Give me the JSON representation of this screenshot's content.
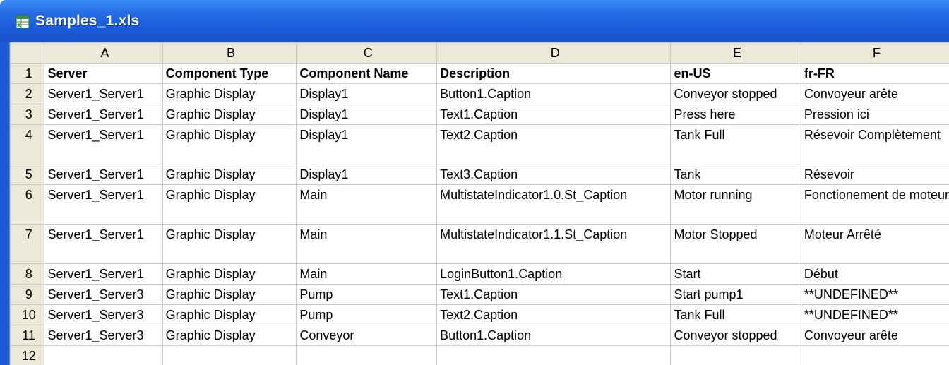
{
  "window": {
    "title": "Samples_1.xls",
    "icon": "excel-sheet-icon"
  },
  "colors": {
    "titlebar": "#2469e3",
    "header_bg": "#ece9d8",
    "grid_line": "#c8c8c8"
  },
  "columns": [
    "A",
    "B",
    "C",
    "D",
    "E",
    "F"
  ],
  "row_numbers": [
    "1",
    "2",
    "3",
    "4",
    "5",
    "6",
    "7",
    "8",
    "9",
    "10",
    "11",
    "12"
  ],
  "rows": [
    [
      "Server",
      "Component Type",
      "Component Name",
      "Description",
      "en-US",
      "fr-FR"
    ],
    [
      "Server1_Server1",
      "Graphic Display",
      "Display1",
      "Button1.Caption",
      "Conveyor stopped",
      "Convoyeur arête"
    ],
    [
      "Server1_Server1",
      "Graphic Display",
      "Display1",
      "Text1.Caption",
      "Press here",
      "Pression ici"
    ],
    [
      "Server1_Server1",
      "Graphic Display",
      "Display1",
      "Text2.Caption",
      "Tank Full",
      "Résevoir Complètement"
    ],
    [
      "Server1_Server1",
      "Graphic Display",
      "Display1",
      "Text3.Caption",
      "Tank",
      "Résevoir"
    ],
    [
      "Server1_Server1",
      "Graphic Display",
      "Main",
      "MultistateIndicator1.0.St_Caption",
      "Motor running",
      "Fonctionement de moteur"
    ],
    [
      "Server1_Server1",
      "Graphic Display",
      "Main",
      "MultistateIndicator1.1.St_Caption",
      "Motor Stopped",
      "Moteur Arrêté"
    ],
    [
      "Server1_Server1",
      "Graphic Display",
      "Main",
      "LoginButton1.Caption",
      "Start",
      "Début"
    ],
    [
      "Server1_Server3",
      "Graphic Display",
      "Pump",
      "Text1.Caption",
      "Start pump1",
      "**UNDEFINED**"
    ],
    [
      "Server1_Server3",
      "Graphic Display",
      "Pump",
      "Text2.Caption",
      "Tank Full",
      "**UNDEFINED**"
    ],
    [
      "Server1_Server3",
      "Graphic Display",
      "Conveyor",
      "Button1.Caption",
      "Conveyor stopped",
      "Convoyeur arête"
    ],
    [
      "",
      "",
      "",
      "",
      "",
      ""
    ]
  ]
}
